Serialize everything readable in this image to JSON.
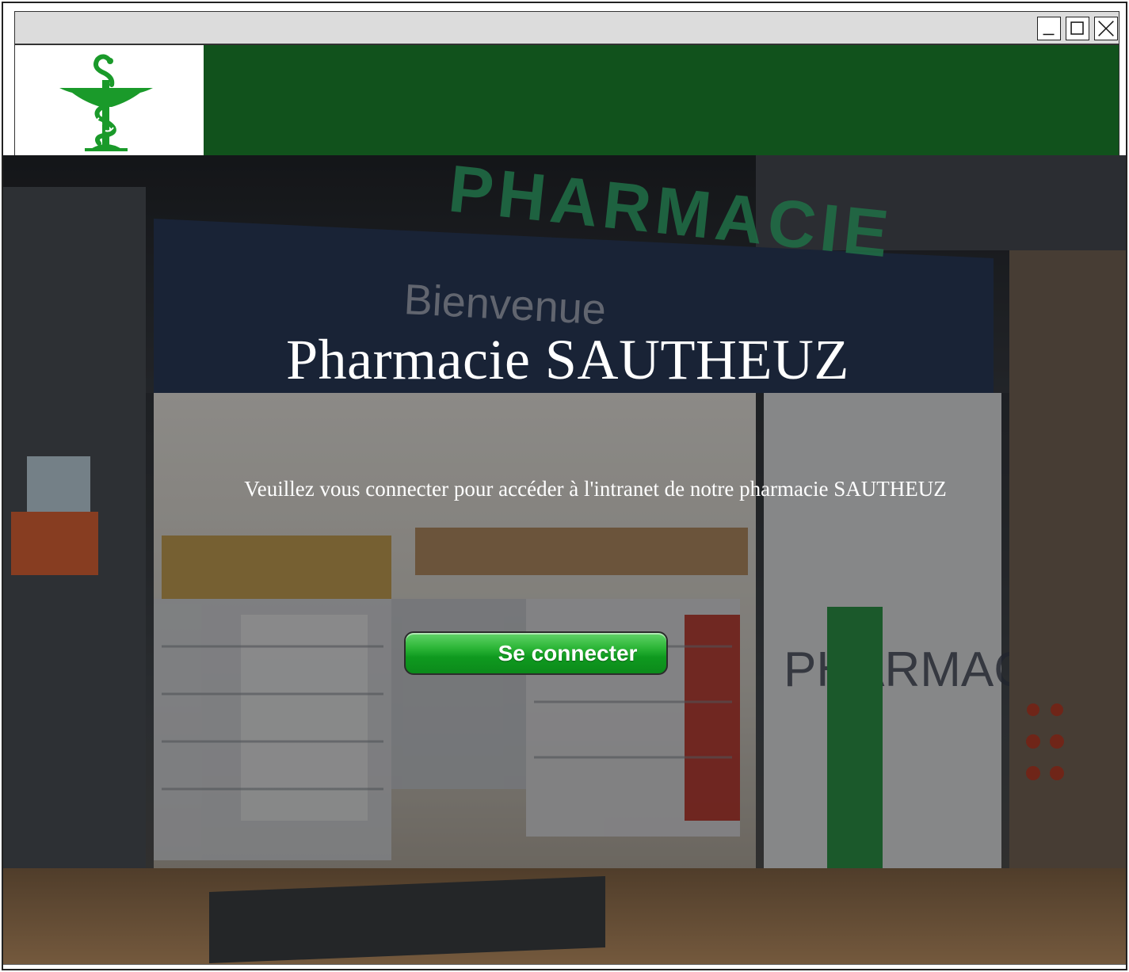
{
  "window": {
    "controls": {
      "minimize_icon": "minimize-icon",
      "maximize_icon": "maximize-icon",
      "close_icon": "close-icon"
    }
  },
  "header": {
    "logo_icon": "pharmacy-caduceus-icon",
    "brand_color": "#11521c",
    "logo_color": "#1a9a2a"
  },
  "hero": {
    "background": "pharmacy-storefront-photo",
    "storefront_sign": "PHARMACIE",
    "storefront_welcome": "Bienvenue",
    "title": "Pharmacie SAUTHEUZ",
    "subtitle": "Veuillez vous connecter pour accéder à l'intranet de notre pharmacie SAUTHEUZ",
    "connect_label": "Se connecter",
    "connect_color": "#1aa22a"
  }
}
